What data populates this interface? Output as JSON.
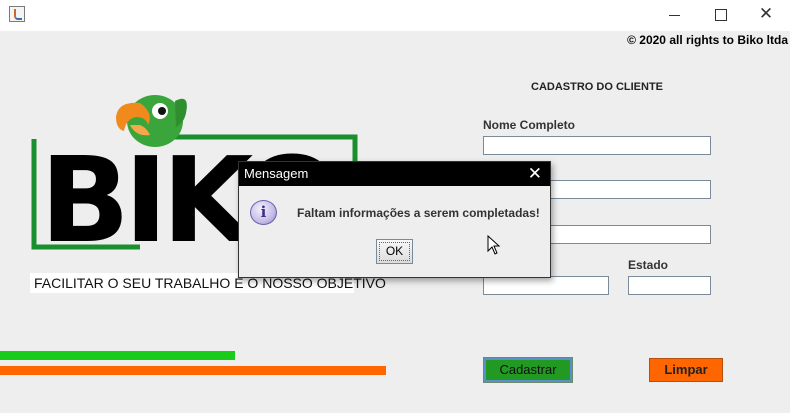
{
  "window": {
    "title": "",
    "controls": {
      "minimize": "—",
      "maximize": "☐",
      "close": "✕"
    }
  },
  "header": {
    "copyright": "© 2020 all rights to Biko ltda"
  },
  "form": {
    "title": "CADASTRO DO CLIENTE",
    "fields": [
      {
        "label": "Nome Completo",
        "value": ""
      },
      {
        "label": "",
        "value": ""
      },
      {
        "label": "",
        "value": ""
      },
      {
        "label": "",
        "value": ""
      },
      {
        "label": "Estado",
        "value": ""
      }
    ]
  },
  "logo": {
    "text": "BIKO",
    "tagline": "FACILITAR O SEU TRABALHO É O NOSSO OBJETIVO",
    "colors": {
      "green": "#1a8f2e",
      "parrot_green": "#3aa53a",
      "beak": "#f08a1c"
    }
  },
  "buttons": {
    "cadastrar": "Cadastrar",
    "limpar": "Limpar"
  },
  "dialog": {
    "title": "Mensagem",
    "close": "✕",
    "icon": "info-icon",
    "icon_glyph": "i",
    "message": "Faltam informações a serem completadas!",
    "ok": "OK"
  },
  "colors": {
    "accent_green": "#1acc1a",
    "accent_orange": "#ff6600",
    "button_green": "#229922"
  }
}
